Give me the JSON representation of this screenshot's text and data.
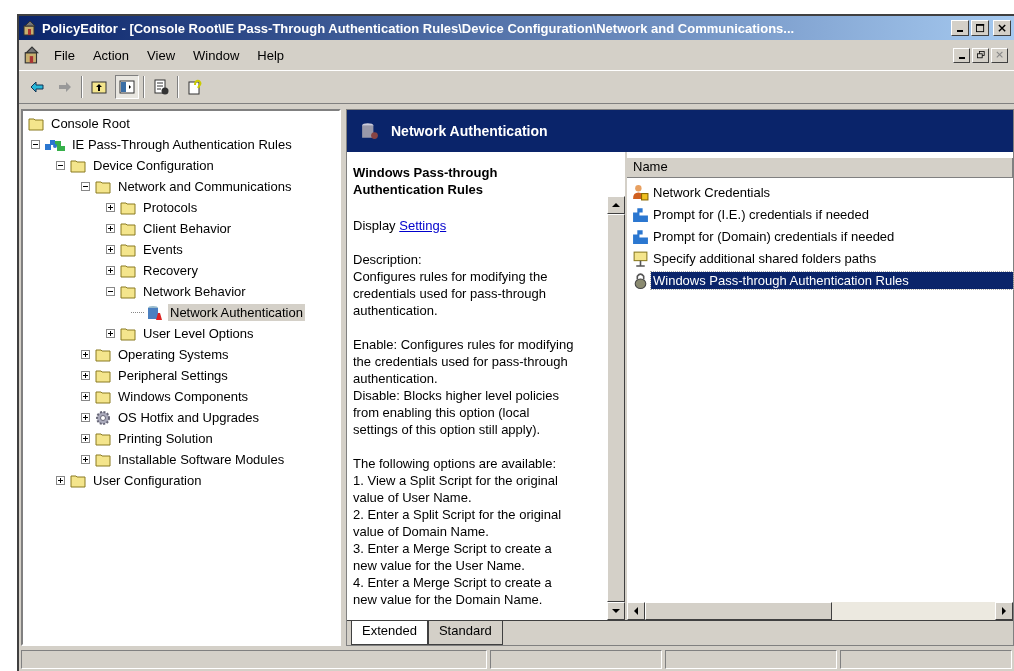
{
  "window": {
    "title": "PolicyEditor - [Console Root\\IE Pass-Through Authentication Rules\\Device Configuration\\Network and Communications..."
  },
  "menu": [
    "File",
    "Action",
    "View",
    "Window",
    "Help"
  ],
  "toolbar": [
    {
      "kind": "back",
      "pressed": false
    },
    {
      "kind": "forward",
      "pressed": false
    },
    {
      "kind": "up",
      "pressed": false
    },
    {
      "kind": "tree",
      "pressed": true
    },
    {
      "kind": "export",
      "pressed": false
    },
    {
      "kind": "help",
      "pressed": false
    }
  ],
  "tree": {
    "root": {
      "label": "Console Root",
      "selected": false
    },
    "children": [
      {
        "label": "IE Pass-Through Authentication Rules",
        "kind": "rules",
        "expanded": true,
        "selected": false,
        "children": [
          {
            "label": "Device Configuration",
            "kind": "folder",
            "expanded": true,
            "selected": false,
            "children": [
              {
                "label": "Network and Communications",
                "kind": "folder",
                "expanded": true,
                "selected": false,
                "children": [
                  {
                    "label": "Protocols",
                    "kind": "folder",
                    "expanded": false,
                    "selected": false
                  },
                  {
                    "label": "Client Behavior",
                    "kind": "folder",
                    "expanded": false,
                    "selected": false
                  },
                  {
                    "label": "Events",
                    "kind": "folder",
                    "expanded": false,
                    "selected": false
                  },
                  {
                    "label": "Recovery",
                    "kind": "folder",
                    "expanded": false,
                    "selected": false
                  },
                  {
                    "label": "Network Behavior",
                    "kind": "folder",
                    "expanded": true,
                    "selected": false,
                    "children": [
                      {
                        "label": "Network Authentication",
                        "kind": "policy",
                        "selected": true
                      }
                    ]
                  },
                  {
                    "label": "User Level Options",
                    "kind": "folder",
                    "expanded": false,
                    "selected": false
                  }
                ]
              },
              {
                "label": "Operating Systems",
                "kind": "folder",
                "expanded": false,
                "selected": false
              },
              {
                "label": "Peripheral  Settings",
                "kind": "folder",
                "expanded": false,
                "selected": false
              },
              {
                "label": "Windows Components",
                "kind": "folder",
                "expanded": false,
                "selected": false
              },
              {
                "label": "OS Hotfix and  Upgrades",
                "kind": "gear",
                "expanded": false,
                "selected": false
              },
              {
                "label": "Printing Solution",
                "kind": "folder",
                "expanded": false,
                "selected": false
              },
              {
                "label": "Installable Software Modules",
                "kind": "folder",
                "expanded": false,
                "selected": false
              }
            ]
          },
          {
            "label": "User Configuration",
            "kind": "folder",
            "expanded": false,
            "selected": false
          }
        ]
      }
    ]
  },
  "header": {
    "title": "Network Authentication"
  },
  "description": {
    "title": "Windows Pass-through\nAuthentication Rules",
    "display_label": "Display",
    "display_link": "Settings",
    "paragraphs": [
      "Description:\nConfigures rules for modifying the\ncredentials used for pass-through\nauthentication.",
      "Enable: Configures rules for modifying\nthe credentials used for pass-through\nauthentication.\nDisable: Blocks higher level policies\nfrom enabling this option (local\nsettings of this option still apply).",
      "The following options are available:\n 1. View a Split Script for the original\nvalue of User Name.\n 2. Enter a Split Script for the original\nvalue of Domain Name.\n 3. Enter a Merge Script to create a\nnew value for the User Name.\n 4. Enter a Merge Script to create a\nnew value for the Domain Name."
    ]
  },
  "tabs": [
    {
      "label": "Extended",
      "selected": true
    },
    {
      "label": "Standard",
      "selected": false
    }
  ],
  "list": {
    "columns": [
      "Name"
    ],
    "items": [
      {
        "name": "Network Credentials",
        "kind": "users",
        "selected": false
      },
      {
        "name": "Prompt for (I.E.) credentials if needed",
        "kind": "puzzle",
        "selected": false
      },
      {
        "name": "Prompt for (Domain) credentials if needed",
        "kind": "puzzle",
        "selected": false
      },
      {
        "name": "Specify additional shared folders paths",
        "kind": "share",
        "selected": false
      },
      {
        "name": "Windows Pass-through Authentication Rules",
        "kind": "lock",
        "selected": true
      }
    ]
  }
}
